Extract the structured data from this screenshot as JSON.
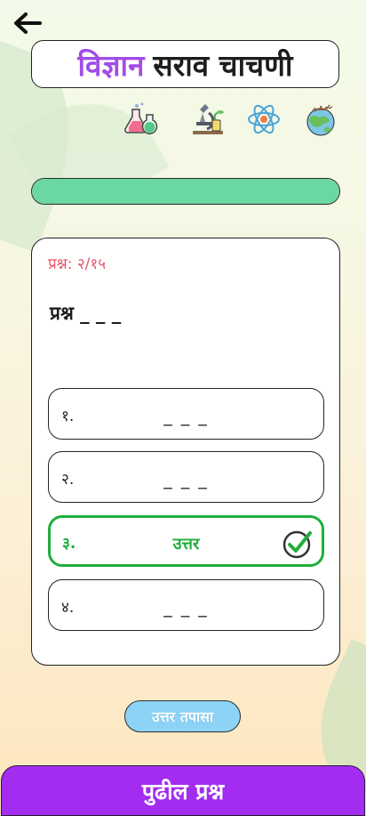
{
  "header": {
    "title_accent": "विज्ञान",
    "title_rest": "सराव चाचणी"
  },
  "icons": [
    "flask-icon",
    "microscope-icon",
    "atom-icon",
    "globe-icon"
  ],
  "progress": {
    "fraction": 1.0,
    "fill_color": "#6ad8a0"
  },
  "quiz": {
    "counter": "प्रश्न: २/१५",
    "question": "प्रश्न _ _ _",
    "options": [
      {
        "num": "१.",
        "text": "_ _ _",
        "state": "default"
      },
      {
        "num": "२.",
        "text": "_ _ _",
        "state": "default"
      },
      {
        "num": "३.",
        "text": "उत्तर",
        "state": "correct"
      },
      {
        "num": "४.",
        "text": "_ _ _",
        "state": "default"
      }
    ]
  },
  "actions": {
    "check_label": "उत्तर तपासा",
    "next_label": "पुढील प्रश्न"
  },
  "colors": {
    "accent_purple": "#a22df0",
    "title_purple": "#a24ce8",
    "correct_green": "#1fae3b",
    "counter_red": "#e8576d",
    "check_blue": "#8cd3f6"
  }
}
